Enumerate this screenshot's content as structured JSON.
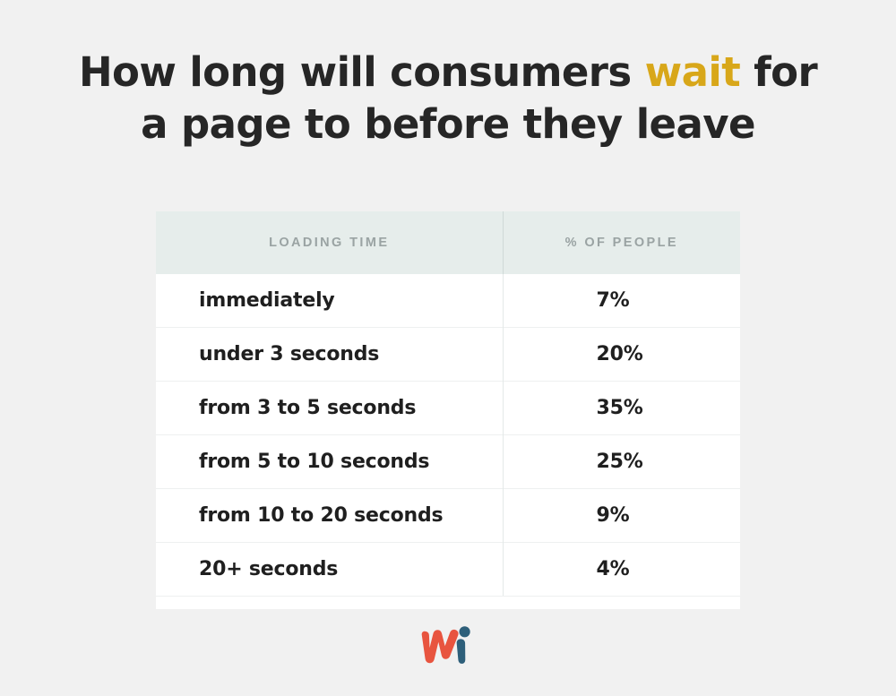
{
  "page": {
    "background_color": "#f1f1f1"
  },
  "title": {
    "line1_before": "How long will consumers ",
    "line1_accent": "wait",
    "line1_after": " for",
    "line2": "a page to before they leave",
    "accent_color": "#d8a71a",
    "text_color": "#262626"
  },
  "table": {
    "header_background": "#e6edeb",
    "header_text_color": "#9aa3a3",
    "row_background": "#ffffff",
    "columns": [
      {
        "key": "loading_time",
        "label": "LOADING TIME"
      },
      {
        "key": "percent_of_people",
        "label": "% OF PEOPLE"
      }
    ],
    "rows": [
      {
        "loading_time": "immediately",
        "percent_of_people": "7%"
      },
      {
        "loading_time": "under 3 seconds",
        "percent_of_people": "20%"
      },
      {
        "loading_time": "from 3 to 5 seconds",
        "percent_of_people": "35%"
      },
      {
        "loading_time": "from 5 to 10 seconds",
        "percent_of_people": "25%"
      },
      {
        "loading_time": "from 10 to 20 seconds",
        "percent_of_people": "9%"
      },
      {
        "loading_time": "20+ seconds",
        "percent_of_people": "4%"
      }
    ]
  },
  "chart_data": {
    "type": "table",
    "title": "How long will consumers wait for a page to before they leave",
    "xlabel": "LOADING TIME",
    "ylabel": "% OF PEOPLE",
    "categories": [
      "immediately",
      "under 3 seconds",
      "from 3 to 5 seconds",
      "from 5 to 10 seconds",
      "from 10 to 20 seconds",
      "20+ seconds"
    ],
    "values": [
      7,
      20,
      35,
      25,
      9,
      4
    ],
    "value_unit": "%",
    "value_labels": [
      "7%",
      "20%",
      "35%",
      "25%",
      "9%",
      "4%"
    ],
    "grid": false,
    "legend": null
  },
  "logo": {
    "name": "wi-logo",
    "w_color": "#e8543f",
    "i_color": "#2e5f7a"
  }
}
